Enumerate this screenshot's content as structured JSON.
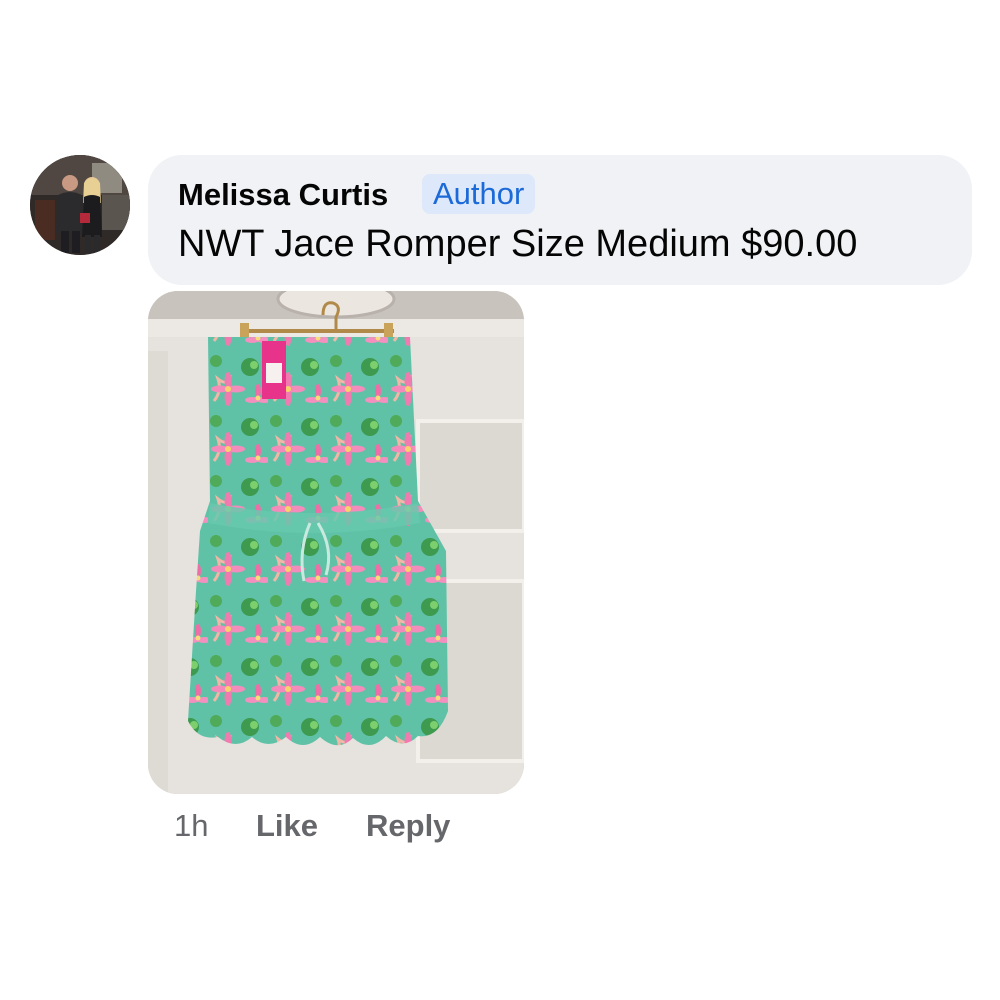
{
  "comment": {
    "author_name": "Melissa Curtis",
    "author_badge": "Author",
    "text": "NWT Jace Romper Size Medium $90.00",
    "timestamp": "1h",
    "like_label": "Like",
    "reply_label": "Reply"
  },
  "colors": {
    "bubble_background": "#f0f2f5",
    "badge_text": "#1b6ad8",
    "badge_background": "#dde9fa",
    "action_text": "#65676b",
    "romper_base": "#5fc2a7",
    "romper_flower": "#f07bb0",
    "price_tag": "#e8338a"
  },
  "icons": {
    "avatar": "profile-photo",
    "attachment": "romper-photo"
  }
}
